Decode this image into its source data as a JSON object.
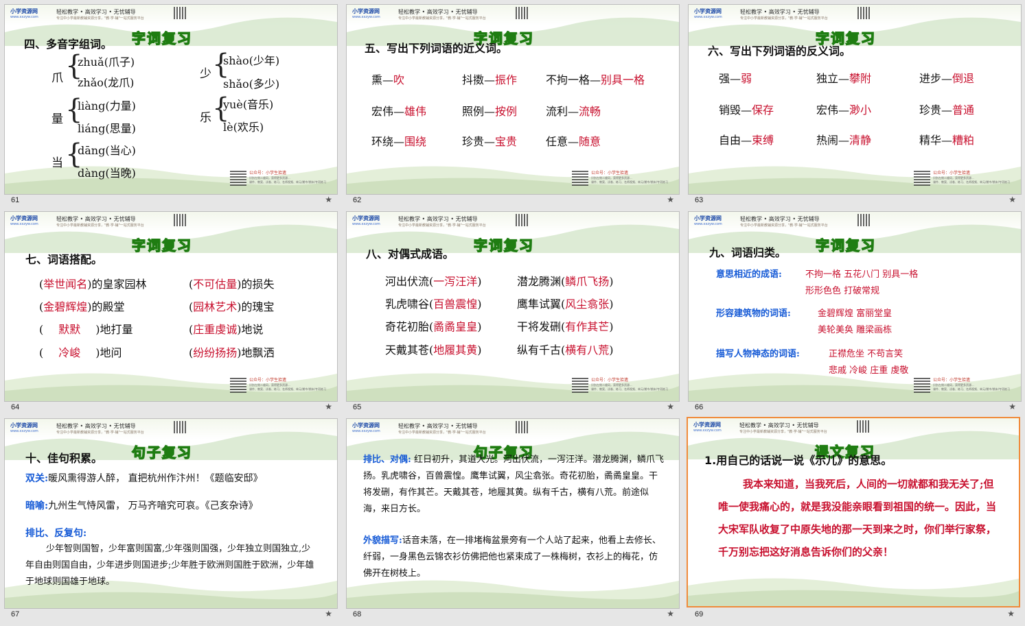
{
  "banner": {
    "brand": "小学资源网",
    "brand_sub": "www.xxzyw.com",
    "tagline": "轻松教学 • 高效学习 • 无忧辅导",
    "tagline_sub": "专注中小学最新教辅资源分享，\"教·学·辅\"一站式服务平台",
    "pub": "公众号：小学生拾遗",
    "pub_sub": "识别左侧二维码，获得更多资源...",
    "pub_sub2": "课件、教案、试卷、练习、名师视频、单元/期中/期末/专项练习"
  },
  "badges": {
    "ci": "字词复习",
    "ju": "句子复习",
    "ke": "课文复习"
  },
  "slides": [
    {
      "num": "61",
      "heading": "四、多音字组词。",
      "groups": [
        {
          "char": "爪",
          "a": "zhuǎ(爪子)",
          "b": "zhǎo(龙爪)"
        },
        {
          "char": "少",
          "a": "shào(少年)",
          "b": "shǎo(多少)"
        },
        {
          "char": "量",
          "a": "liàng(力量)",
          "b": "liáng(思量)"
        },
        {
          "char": "乐",
          "a": "yuè(音乐)",
          "b": "lè(欢乐)"
        },
        {
          "char": "当",
          "a": "dāng(当心)",
          "b": "dàng(当晚)"
        }
      ]
    },
    {
      "num": "62",
      "heading": "五、写出下列词语的近义词。",
      "pairs": [
        {
          "w": "熏—",
          "a": "吹"
        },
        {
          "w": "抖擞—",
          "a": "振作"
        },
        {
          "w": "不拘一格—",
          "a": "别具一格"
        },
        {
          "w": "宏伟—",
          "a": "雄伟"
        },
        {
          "w": "照例—",
          "a": "按例"
        },
        {
          "w": "流利—",
          "a": "流畅"
        },
        {
          "w": "环绕—",
          "a": "围绕"
        },
        {
          "w": "珍贵—",
          "a": "宝贵"
        },
        {
          "w": "任意—",
          "a": "随意"
        }
      ]
    },
    {
      "num": "63",
      "heading": "六、写出下列词语的反义词。",
      "pairs": [
        {
          "w": "强—",
          "a": "弱"
        },
        {
          "w": "独立—",
          "a": "攀附"
        },
        {
          "w": "进步—",
          "a": "倒退"
        },
        {
          "w": "销毁—",
          "a": "保存"
        },
        {
          "w": "宏伟—",
          "a": "渺小"
        },
        {
          "w": "珍贵—",
          "a": "普通"
        },
        {
          "w": "自由—",
          "a": "束缚"
        },
        {
          "w": "热闹—",
          "a": "清静"
        },
        {
          "w": "精华—",
          "a": "糟粕"
        }
      ]
    },
    {
      "num": "64",
      "heading": "七、词语搭配。",
      "rows": [
        {
          "l1": "(",
          "a1": "举世闻名",
          "r1": ")的皇家园林",
          "l2": "(",
          "a2": "不可估量",
          "r2": ")的损失"
        },
        {
          "l1": "(",
          "a1": "金碧辉煌",
          "r1": ")的殿堂",
          "l2": "(",
          "a2": "园林艺术",
          "r2": ")的瑰宝"
        },
        {
          "l1": "(",
          "a1": "默默",
          "r1": ")地打量",
          "l2": "(",
          "a2": "庄重虔诚",
          "r2": ")地说"
        },
        {
          "l1": "(",
          "a1": "冷峻",
          "r1": ")地问",
          "l2": "(",
          "a2": "纷纷扬扬",
          "r2": ")地飘洒"
        }
      ]
    },
    {
      "num": "65",
      "heading": "八、对偶式成语。",
      "rows": [
        {
          "p1": "河出伏流(",
          "a1": "一泻汪洋",
          "s1": ")",
          "p2": "潜龙腾渊(",
          "a2": "鳞爪飞扬",
          "s2": ")"
        },
        {
          "p1": "乳虎啸谷(",
          "a1": "百兽震惶",
          "s1": ")",
          "p2": "鹰隼试翼(",
          "a2": "风尘翕张",
          "s2": ")"
        },
        {
          "p1": "奇花初胎(",
          "a1": "矞矞皇皇",
          "s1": ")",
          "p2": "干将发硎(",
          "a2": "有作其芒",
          "s2": ")"
        },
        {
          "p1": "天戴其苍(",
          "a1": "地履其黄",
          "s1": ")",
          "p2": "纵有千古(",
          "a2": "横有八荒",
          "s2": ")"
        }
      ]
    },
    {
      "num": "66",
      "heading": "九、词语归类。",
      "cats": [
        {
          "label": "意思相近的成语:",
          "l1": "不拘一格    五花八门    别具一格",
          "l2": "形形色色    打破常规"
        },
        {
          "label": "形容建筑物的词语:",
          "l1": "金碧辉煌  富丽堂皇",
          "l2": "美轮美奂  雕梁画栋"
        },
        {
          "label": "描写人物神态的词语:",
          "l1": "正襟危坐      不苟言笑",
          "l2": "悲戚    冷峻    庄重    虔敬"
        }
      ]
    },
    {
      "num": "67",
      "heading": "十、佳句积累。",
      "items": [
        {
          "label": "双关:",
          "text": "暖风熏得游人醉，  直把杭州作汴州！《题临安邸》"
        },
        {
          "label": "暗喻:",
          "text": "九州生气恃风雷，  万马齐喑究可哀。《己亥杂诗》"
        },
        {
          "label": "排比、反复句:",
          "text": ""
        }
      ],
      "para": "少年智则国智，少年富则国富,少年强则国强，少年独立则国独立,少年自由则国自由，少年进步则国进步;少年胜于欧洲则国胜于欧洲，少年雄于地球则国雄于地球。"
    },
    {
      "num": "68",
      "label1": "排比、对偶:",
      "text1": "红日初升，其道大光。河出伏流，一泻汪洋。潜龙腾渊，鳞爪飞扬。乳虎啸谷，百兽震惶。鹰隼试翼，风尘翕张。奇花初胎，矞矞皇皇。干将发硎，有作其芒。天戴其苍，地履其黄。纵有千古，横有八荒。前途似海，来日方长。",
      "label2": "外貌描写:",
      "text2": "话音未落，在一排堵梅盆景旁有一个人站了起来，他看上去修长、纤弱，一身黑色云锦衣衫仿佛把他也紧束成了一株梅树，衣衫上的梅花，仿佛开在树枝上。"
    },
    {
      "num": "69",
      "heading": "1.用自己的话说一说《示儿》的意思。",
      "para": "我本来知道，当我死后，人间的一切就都和我无关了;但唯一使我痛心的，就是我没能亲眼看到祖国的统一。因此，当大宋军队收复了中原失地的那一天到来之时，你们举行家祭，千万别忘把这好消息告诉你们的父亲！"
    }
  ],
  "star": "★"
}
